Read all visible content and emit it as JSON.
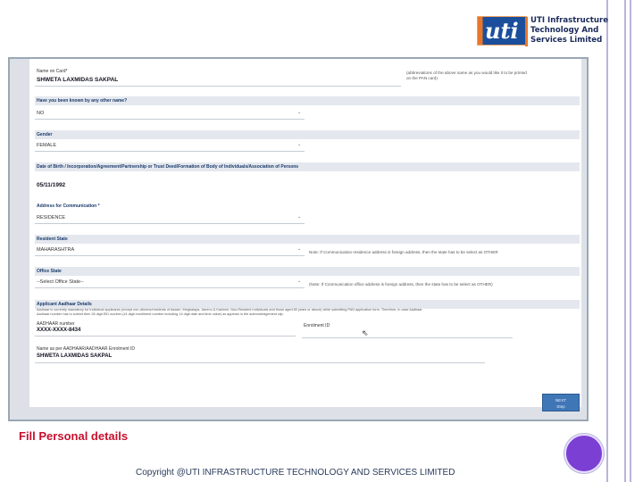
{
  "logo": {
    "mark": "uti",
    "line1": "UTI Infrastructure",
    "line2": "Technology And",
    "line3": "Services Limited"
  },
  "form": {
    "name_on_card_label": "Name on Card*",
    "name_on_card_value": "SHWETA LAXMIDAS SAKPAL",
    "name_on_card_note_1": "(abbreviations of the above name as you would like it to be printed",
    "name_on_card_note_2": "on the PAN card)",
    "other_name_label": "Have you been known by any other name?",
    "other_name_value": "NO",
    "gender_label": "Gender",
    "gender_value": "FEMALE",
    "dob_label": "Date of Birth / Incorporation/Agreement/Partnership or Trust Deed/Formation of Body of Individuals/Association of Persons",
    "dob_value": "05/11/1992",
    "address_comm_label": "Address for Communication *",
    "address_comm_value": "RESIDENCE",
    "resident_state_label": "Resident State",
    "resident_state_value": "MAHARASHTRA",
    "resident_state_note": "Note: If Communication residence address is foreign address, then the state has to be select as OTHER",
    "office_state_label": "Office State",
    "office_state_value": "--Select Office State--",
    "office_state_note": "(Note: If Communication office address is foreign address, then the state has to be select as OTHER)",
    "aadhaar_section_label": "Applicant Aadhaar Details",
    "aadhaar_note_1": "Aadhaar is currently mandatory for Individual applicants (except non-citizens/residents of Assam, Meghalaya, Jammu & Kashmir, Non-Resident Individuals and those aged 80 years or above) while submitting PAN application form. Therefore, in case Aadhaar",
    "aadhaar_note_2": "Aadhaar number has to submit then 28 digit EID number (14 digit enrollment number including 14 digit date and time value) as appears in the acknowledgement slip.",
    "aadhaar_number_label": "AADHAAR number",
    "aadhaar_number_value": "XXXX-XXXX-8434",
    "enrolment_id_label": "Enrolment ID",
    "name_per_aadhaar_label": "Name as per AADHAAR/AADHAAR Enrolment ID",
    "name_per_aadhaar_value": "SHWETA LAXMIDAS SAKPAL",
    "next_button_line1": "NEXT",
    "next_button_line2": "Step"
  },
  "caption": "Fill Personal details",
  "copyright": "Copyright @UTI INFRASTRUCTURE TECHNOLOGY AND SERVICES LIMITED",
  "colors": {
    "accent": "#c8102e",
    "brand_blue": "#1b4f9c",
    "brand_orange": "#e8772a",
    "button": "#3f76b6"
  }
}
